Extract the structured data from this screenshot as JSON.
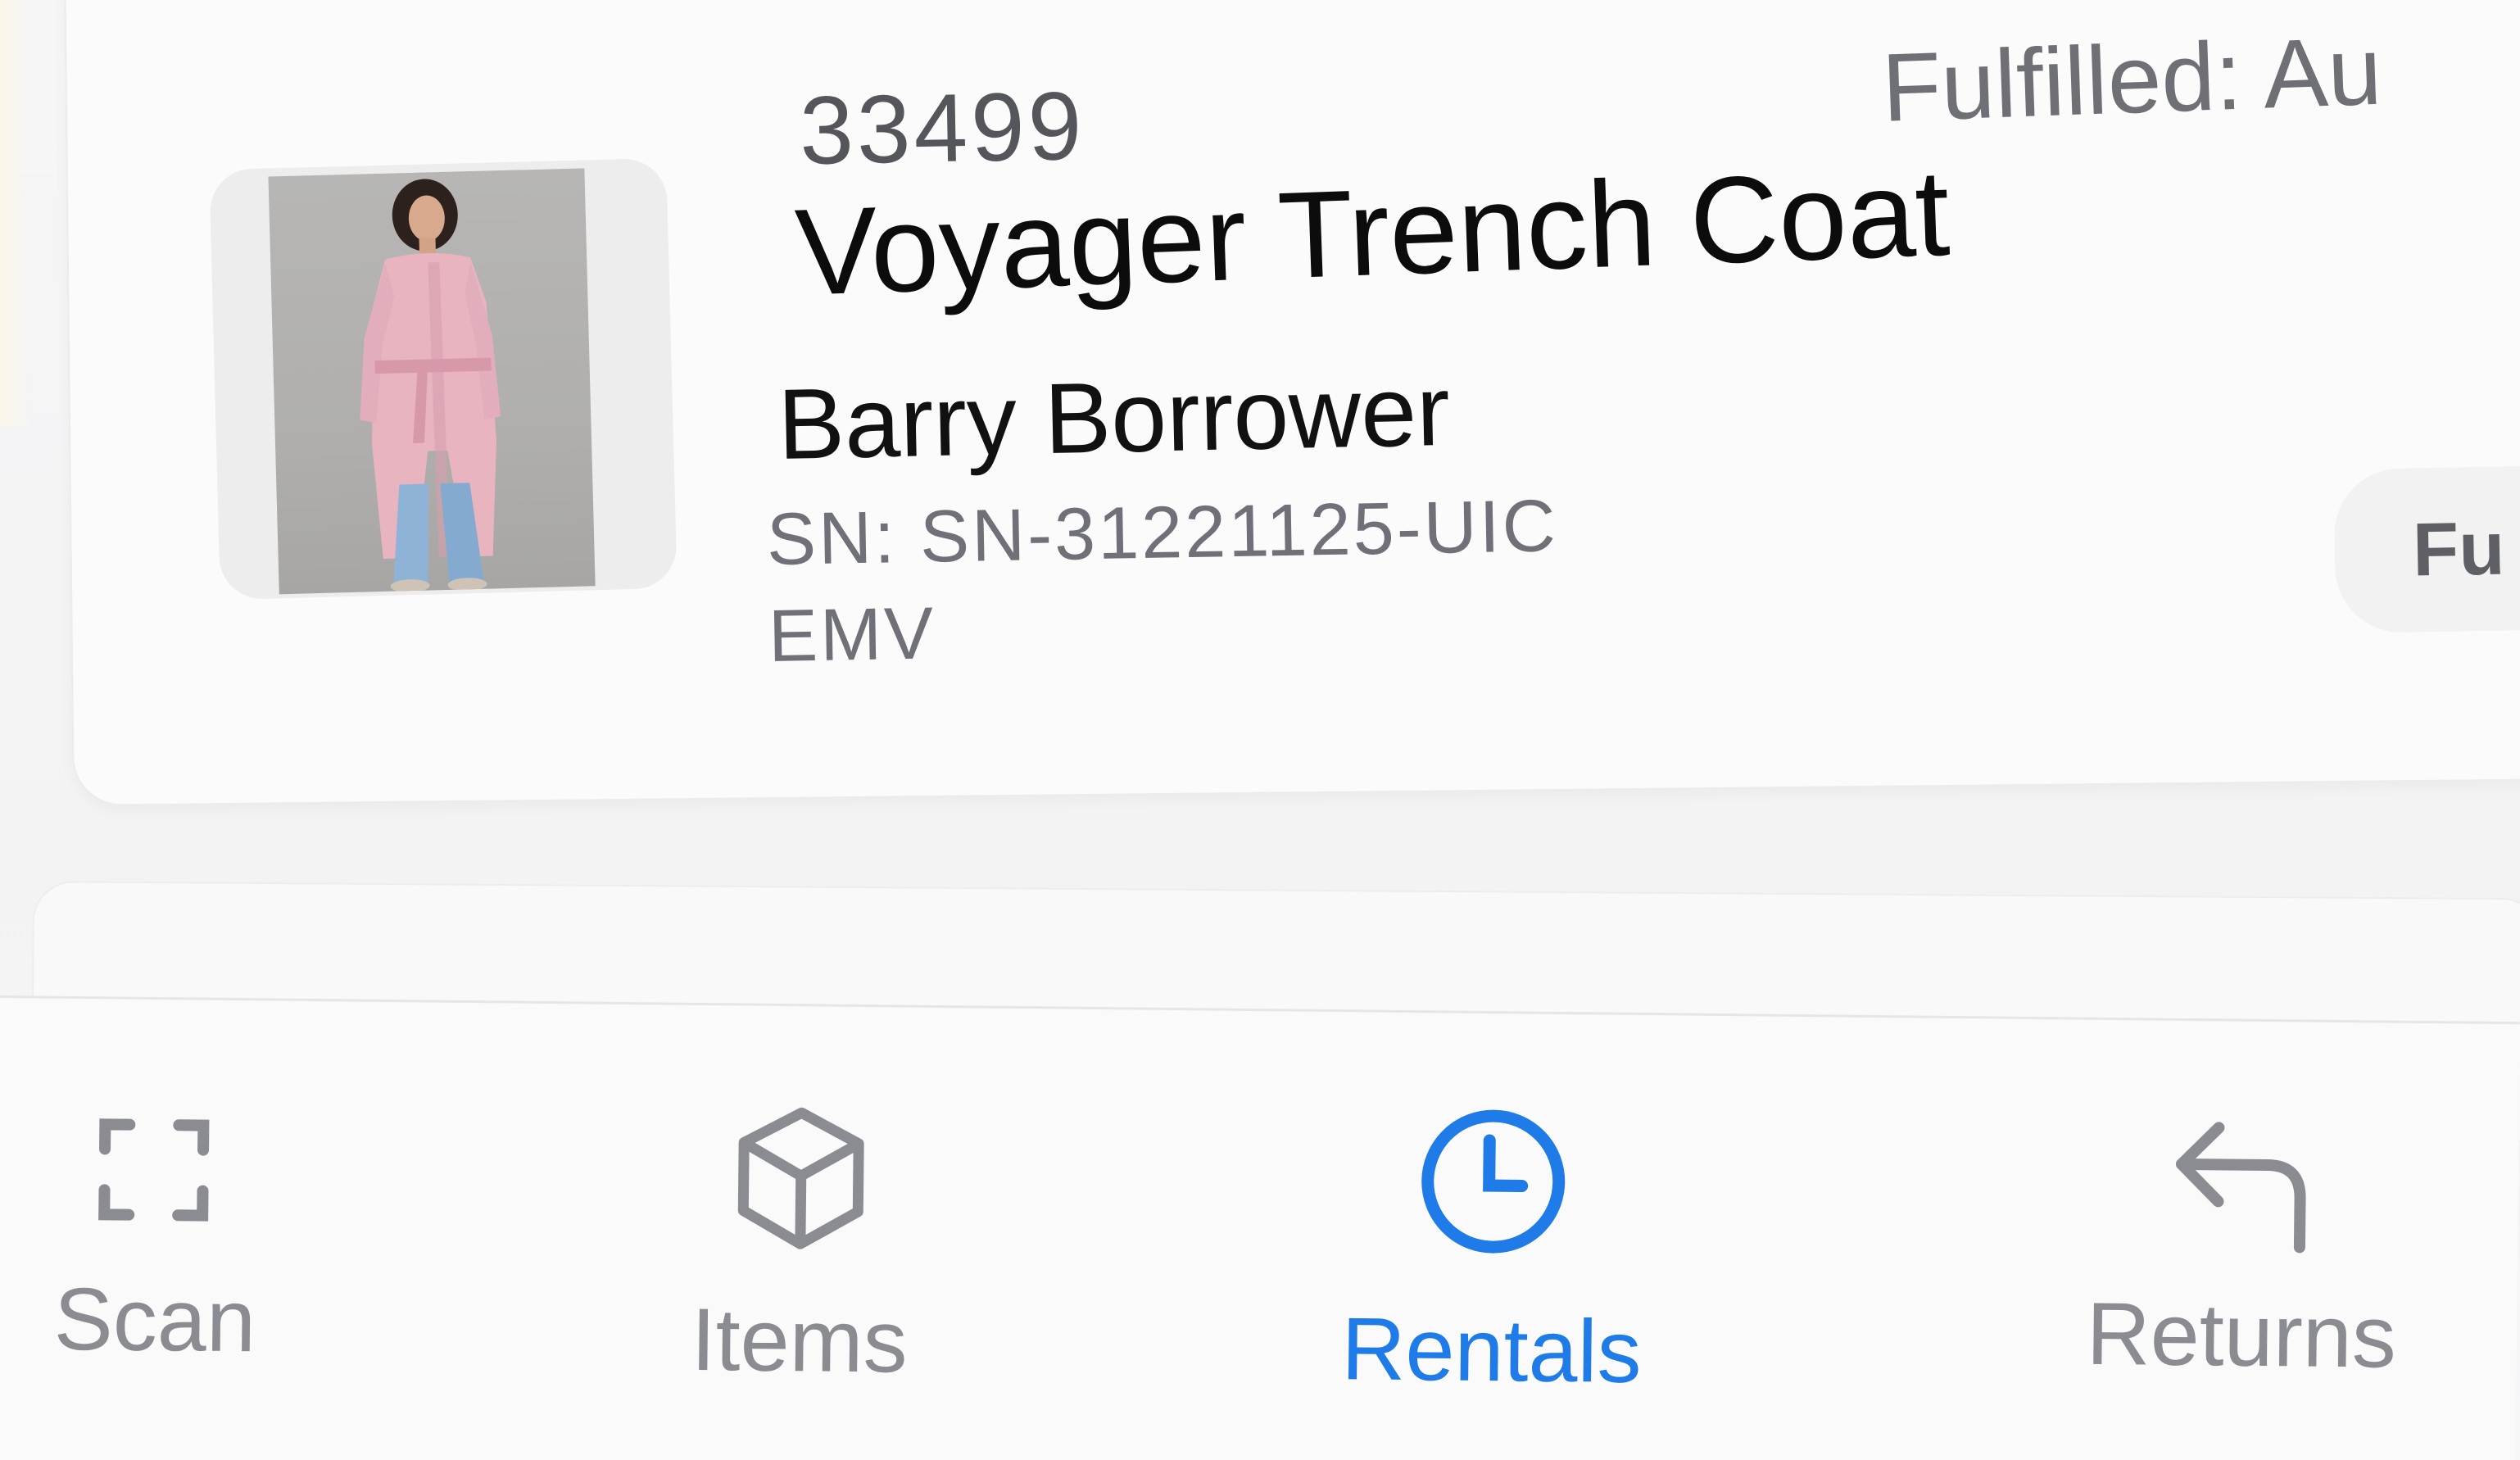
{
  "order": {
    "number": "33499",
    "fulfilled_label": "Fulfilled: Au"
  },
  "item": {
    "name": "Voyager Trench Coat",
    "borrower": "Barry Borrower",
    "serial": "SN: SN-31221125-UICEMV"
  },
  "status_pill": {
    "label": "Fu"
  },
  "tabbar": {
    "tabs": [
      {
        "label": "Scan",
        "icon": "scan-icon",
        "active": false
      },
      {
        "label": "Items",
        "icon": "box-icon",
        "active": false
      },
      {
        "label": "Rentals",
        "icon": "clock-icon",
        "active": true
      },
      {
        "label": "Returns",
        "icon": "return-arrow-icon",
        "active": false
      }
    ]
  },
  "colors": {
    "accent": "#1e7be8",
    "inactive": "#8b8c92",
    "coat": "#e7b4c0",
    "jeans": "#8fb3d6"
  }
}
